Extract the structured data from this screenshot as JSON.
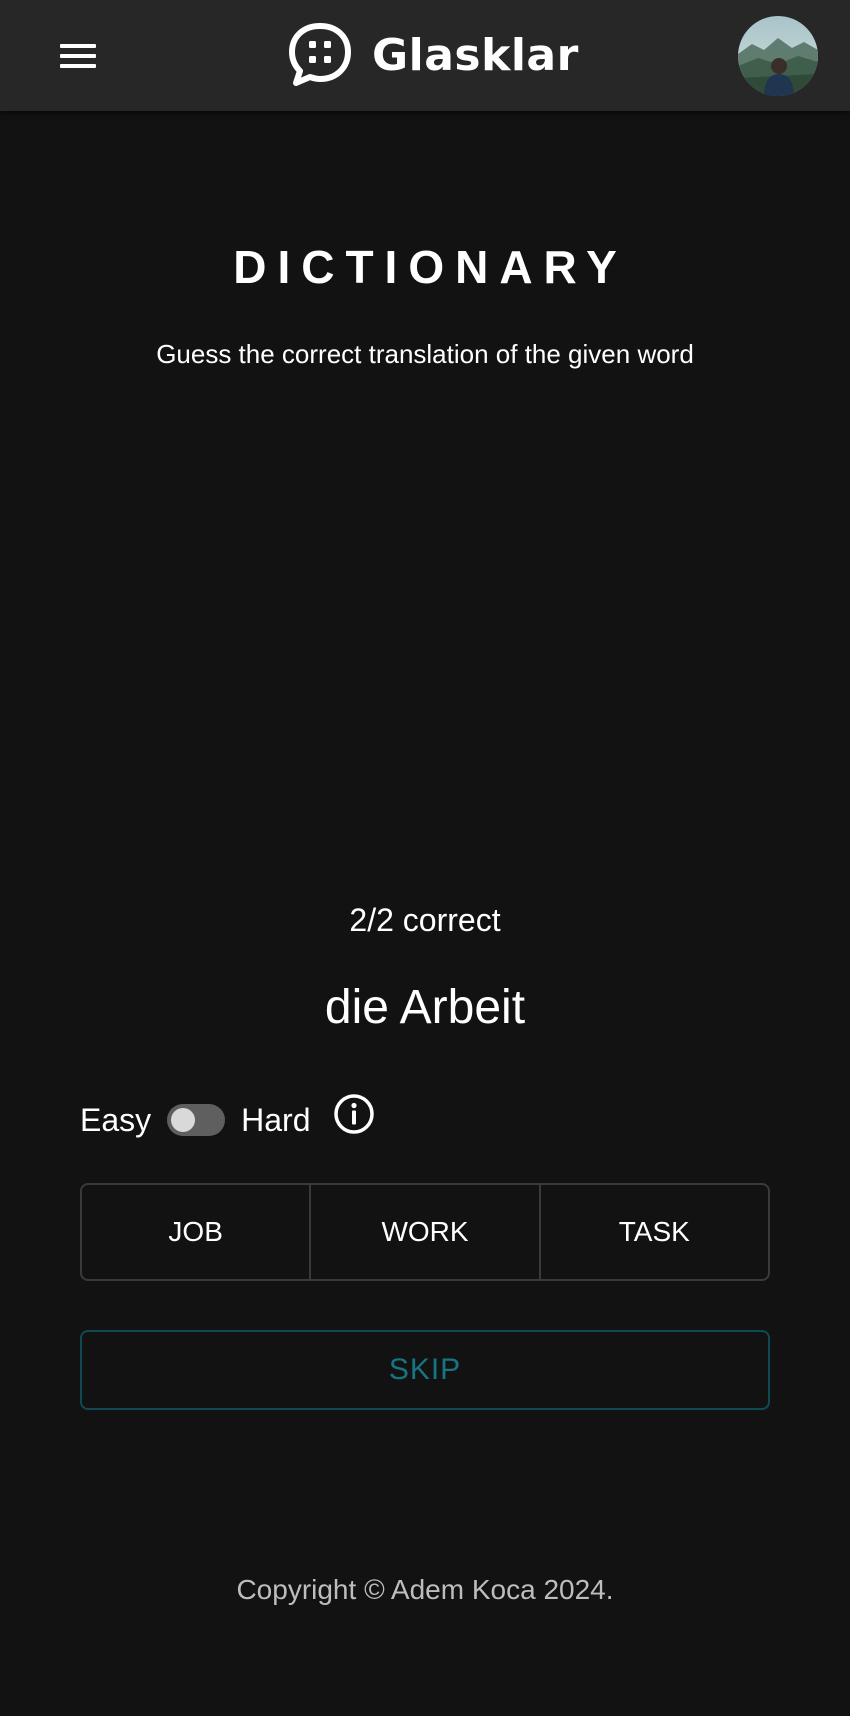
{
  "header": {
    "menu_icon": "hamburger-menu-icon",
    "logo_icon": "chat-bubble-logo-icon",
    "brand_name": "Glasklar",
    "avatar_icon": "user-avatar"
  },
  "main": {
    "title": "DICTIONARY",
    "subtitle": "Guess the correct translation of the given word",
    "score": "2/2 correct",
    "word": "die Arbeit",
    "difficulty": {
      "easy_label": "Easy",
      "hard_label": "Hard",
      "is_hard": false,
      "info_icon": "info-icon"
    },
    "options": [
      "JOB",
      "WORK",
      "TASK"
    ],
    "skip_label": "SKIP"
  },
  "footer": {
    "copyright": "Copyright © Adem Koca 2024."
  },
  "colors": {
    "background": "#121212",
    "header": "#272727",
    "accent": "#167582",
    "text": "#ffffff",
    "muted": "#bdbdbd"
  }
}
